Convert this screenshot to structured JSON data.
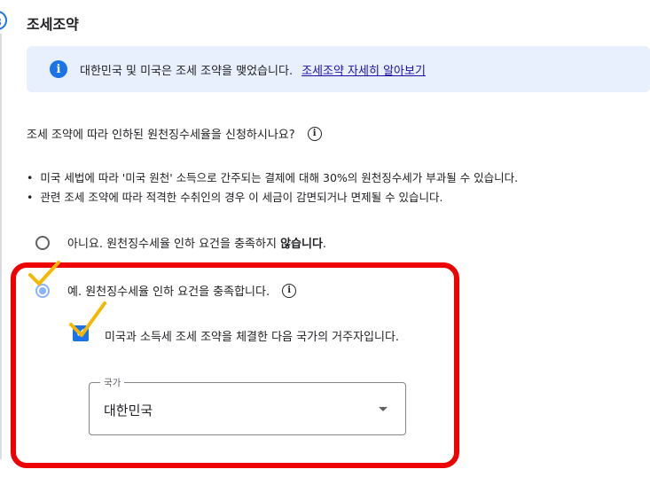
{
  "section": {
    "title": "조세조약"
  },
  "info": {
    "icon": "info-icon",
    "text": "대한민국 및 미국은 조세 조약을 맺었습니다.",
    "link": "조세조약 자세히 알아보기"
  },
  "question": {
    "text": "조세 조약에 따라 인하된 원천징수세율을 신청하시나요?",
    "icon": "help-circle-icon"
  },
  "bullets": [
    "미국 세법에 따라 '미국 원천' 소득으로 간주되는 결제에 대해 30%의 원천징수세가 부과될 수 있습니다.",
    "관련 조세 조약에 따라 적격한 수취인의 경우 이 세금이 감면되거나 면제될 수 있습니다."
  ],
  "options": {
    "no": {
      "label_prefix": "아니요. 원천징수세율 인하 요건을 충족하지 ",
      "label_bold": "않습니다",
      "label_suffix": ".",
      "selected": false
    },
    "yes": {
      "label": "예. 원천징수세율 인하 요건을 충족합니다.",
      "selected": true
    }
  },
  "residency": {
    "label": "미국과 소득세 조세 조약을 체결한 다음 국가의 거주자입니다.",
    "checked": true
  },
  "country": {
    "legend": "국가",
    "value": "대한민국"
  },
  "annotation": {
    "color": "#ee0000",
    "check_color": "#f5b800"
  }
}
